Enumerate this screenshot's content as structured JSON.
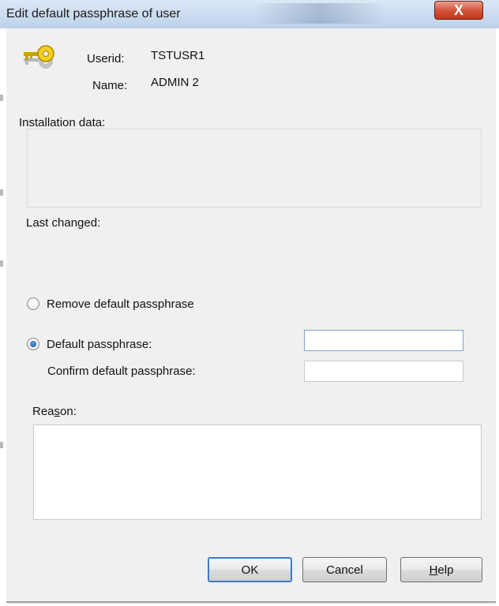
{
  "window": {
    "title": "Edit default passphrase of user",
    "close_glyph": "X"
  },
  "user": {
    "userid_label": "Userid:",
    "userid_value": "TSTUSR1",
    "name_label": "Name:",
    "name_value": "ADMIN 2",
    "icon": "key-icon"
  },
  "installation": {
    "label": "Installation data:",
    "value": ""
  },
  "last_changed": {
    "label": "Last changed:",
    "value": ""
  },
  "options": {
    "remove_label": "Remove default passphrase",
    "default_label": "Default passphrase:",
    "confirm_label": "Confirm default passphrase:",
    "default_value": "",
    "confirm_value": "",
    "selected": "default"
  },
  "reason": {
    "label_pre": "Rea",
    "label_accel": "s",
    "label_post": "on:",
    "value": ""
  },
  "buttons": {
    "ok": "OK",
    "cancel": "Cancel",
    "help_accel": "H",
    "help_rest": "elp"
  },
  "colors": {
    "accent": "#3d7bd0",
    "close": "#c2361c",
    "dialog_bg": "#f0f0f0"
  }
}
